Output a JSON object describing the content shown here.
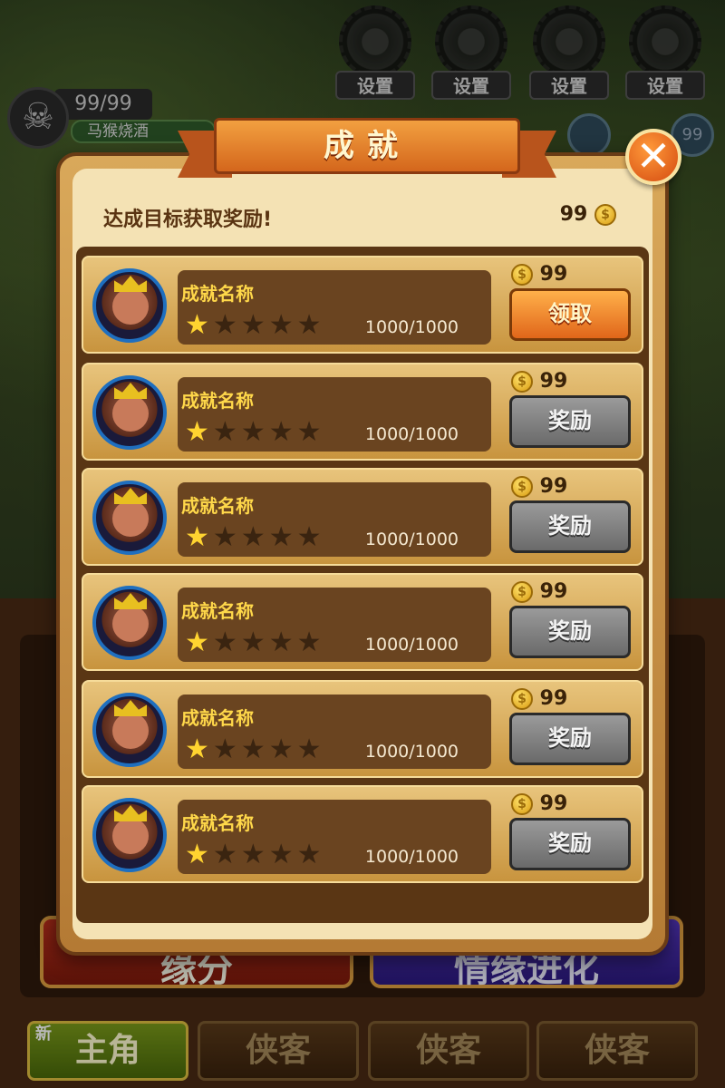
{
  "hud": {
    "settings_buttons": [
      {
        "label": "设置"
      },
      {
        "label": "设置"
      },
      {
        "label": "设置"
      },
      {
        "label": "设置"
      }
    ],
    "hp": "99/99",
    "player_name": "马猴烧酒",
    "side_counter": "99"
  },
  "background_ui": {
    "left_button": "缘分",
    "right_button": "情缘进化",
    "tabs": [
      {
        "label": "主角",
        "badge": "新"
      },
      {
        "label": "侠客"
      },
      {
        "label": "侠客"
      },
      {
        "label": "侠客"
      }
    ]
  },
  "dialog": {
    "title": "成就",
    "close_symbol": "✕",
    "subtitle": "达成目标获取奖励!",
    "coin_total": "99",
    "achievements": [
      {
        "name": "成就名称",
        "stars_filled": 1,
        "stars_total": 5,
        "progress": "1000/1000",
        "reward": "99",
        "button": "领取",
        "state": "claim"
      },
      {
        "name": "成就名称",
        "stars_filled": 1,
        "stars_total": 5,
        "progress": "1000/1000",
        "reward": "99",
        "button": "奖励",
        "state": "disabled"
      },
      {
        "name": "成就名称",
        "stars_filled": 1,
        "stars_total": 5,
        "progress": "1000/1000",
        "reward": "99",
        "button": "奖励",
        "state": "disabled"
      },
      {
        "name": "成就名称",
        "stars_filled": 1,
        "stars_total": 5,
        "progress": "1000/1000",
        "reward": "99",
        "button": "奖励",
        "state": "disabled"
      },
      {
        "name": "成就名称",
        "stars_filled": 1,
        "stars_total": 5,
        "progress": "1000/1000",
        "reward": "99",
        "button": "奖励",
        "state": "disabled"
      },
      {
        "name": "成就名称",
        "stars_filled": 1,
        "stars_total": 5,
        "progress": "1000/1000",
        "reward": "99",
        "button": "奖励",
        "state": "disabled"
      }
    ]
  },
  "colors": {
    "accent_orange": "#e0661a",
    "gold_text": "#ffd84a",
    "panel_brown": "#5a3614"
  }
}
